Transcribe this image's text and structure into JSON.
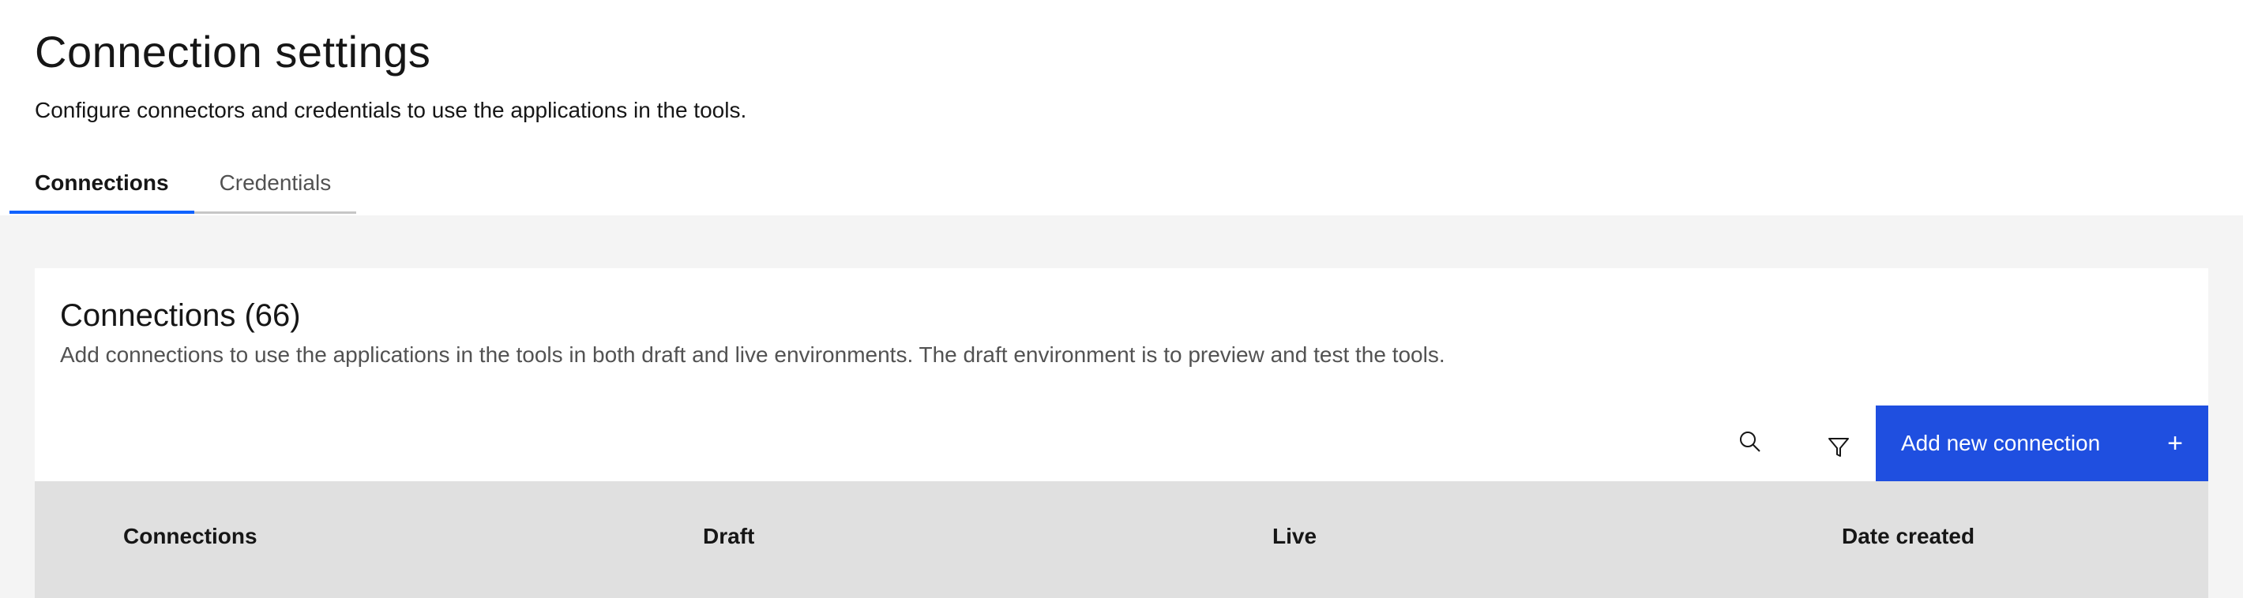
{
  "header": {
    "title": "Connection settings",
    "subtitle": "Configure connectors and credentials to use the applications in the tools."
  },
  "tabs": [
    {
      "label": "Connections",
      "active": true
    },
    {
      "label": "Credentials",
      "active": false
    }
  ],
  "card": {
    "title": "Connections (66)",
    "description": "Add connections to use the applications in the tools in both draft and live environments. The draft environment is to preview and test the tools.",
    "toolbar": {
      "search_icon": "search-icon",
      "filter_icon": "filter-icon",
      "add_button_label": "Add new connection",
      "add_button_icon": "plus-icon"
    },
    "table": {
      "columns": [
        "Connections",
        "Draft",
        "Live",
        "Date created"
      ]
    }
  },
  "colors": {
    "accent": "#0f62fe",
    "primary_button": "#1f4fe0",
    "page_background": "#f4f4f4",
    "table_header": "#e0e0e0"
  }
}
